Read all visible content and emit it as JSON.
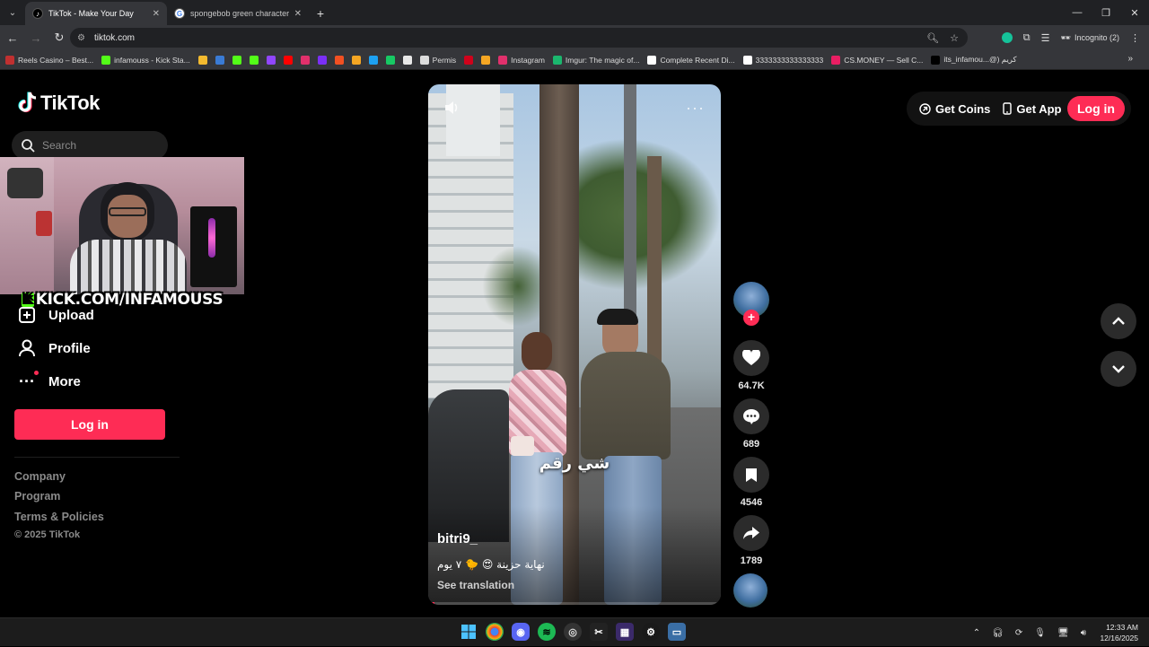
{
  "browser": {
    "tabs": [
      {
        "title": "TikTok - Make Your Day",
        "active": true,
        "favicon": "tiktok-icon"
      },
      {
        "title": "spongebob green character - R",
        "active": false,
        "favicon": "google-icon"
      }
    ],
    "url": "tiktok.com",
    "incognito_label": "Incognito (2)",
    "bookmarks": [
      {
        "label": "Reels Casino – Best...",
        "color": "#c03030"
      },
      {
        "label": "infamouss - Kick Sta...",
        "color": "#53fc18"
      },
      {
        "label": "",
        "color": "#f3ba2f"
      },
      {
        "label": "",
        "color": "#3a7bd5"
      },
      {
        "label": "",
        "color": "#53fc18"
      },
      {
        "label": "",
        "color": "#53fc18"
      },
      {
        "label": "",
        "color": "#9146ff"
      },
      {
        "label": "",
        "color": "#ff0000"
      },
      {
        "label": "",
        "color": "#e1306c"
      },
      {
        "label": "",
        "color": "#7b2ff7"
      },
      {
        "label": "",
        "color": "#f25022"
      },
      {
        "label": "",
        "color": "#f5a623"
      },
      {
        "label": "",
        "color": "#1da1f2"
      },
      {
        "label": "",
        "color": "#17c964"
      },
      {
        "label": "",
        "color": "#e8e8e8"
      },
      {
        "label": "Permis",
        "color": "#dcdcdc"
      },
      {
        "label": "",
        "color": "#d0021b"
      },
      {
        "label": "",
        "color": "#f5a623"
      },
      {
        "label": "Instagram",
        "color": "#e1306c"
      },
      {
        "label": "Imgur: The magic of...",
        "color": "#1bb76e"
      },
      {
        "label": "Complete Recent Di...",
        "color": "#ffffff"
      },
      {
        "label": "3333333333333333",
        "color": "#ffffff"
      },
      {
        "label": "CS.MONEY — Sell C...",
        "color": "#e91e63"
      },
      {
        "label": "its_infamou...@) كريم",
        "color": "#000000"
      }
    ]
  },
  "tiktok": {
    "brand": "TikTok",
    "search_placeholder": "Search",
    "overlay_banner": "KICK.COM/INFAMOUSS",
    "nav": {
      "upload": "Upload",
      "profile": "Profile",
      "more": "More"
    },
    "login_label": "Log in",
    "footer": {
      "company": "Company",
      "program": "Program",
      "terms": "Terms & Policies",
      "copyright": "© 2025 TikTok"
    },
    "top_right": {
      "get_coins": "Get Coins",
      "get_app": "Get App",
      "login": "Log in"
    },
    "video": {
      "caption_overlay": "شي رقم",
      "author": "bitri9_",
      "description": "نهاية حزينة 😍 🐤 ٧ يوم",
      "see_translation": "See translation",
      "progress": 0.02,
      "likes": "64.7K",
      "comments": "689",
      "saves": "4546",
      "shares": "1789"
    }
  },
  "taskbar": {
    "time": "12:33 AM",
    "date": "12/16/2025"
  }
}
